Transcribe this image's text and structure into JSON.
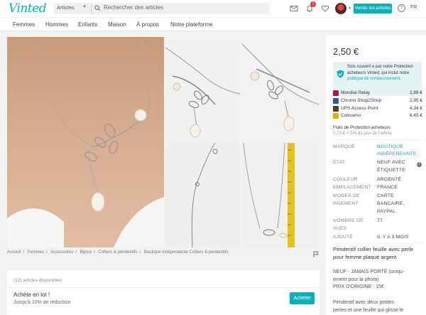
{
  "header": {
    "logo": "Vinted",
    "search_category": "Articles",
    "search_placeholder": "Rechercher des articles",
    "notification_count": "1",
    "sell_button": "Vends tes articles",
    "help": "?",
    "language": "FR"
  },
  "nav": [
    "Femmes",
    "Hommes",
    "Enfants",
    "Maison",
    "À propos",
    "Notre plateforme"
  ],
  "breadcrumb": [
    "Accueil",
    "Femmes",
    "Accessoires",
    "Bijoux",
    "Colliers & pendentifs",
    "Boutique Indépendante Colliers & pendentifs"
  ],
  "bundle": {
    "count_text": "(12) articles disponibles",
    "title": "Achète en lot !",
    "subtitle": "Jusqu'à 10% de réduction",
    "button": "Acheter"
  },
  "item": {
    "price": "2,50 €",
    "protection": {
      "text": "Sois couvert·e par notre Protection acheteurs Vinted, qui inclut notre ",
      "link": "politique de remboursement."
    },
    "shipping": [
      {
        "name": "Mondial Relay",
        "price": "2,88 €",
        "color": "#b0154b"
      },
      {
        "name": "Chrono Shop2Shop",
        "price": "2,95 €",
        "color": "#1f5ea8"
      },
      {
        "name": "UPS Access Point",
        "price": "4,34 €",
        "color": "#5a3a22"
      },
      {
        "name": "Colissimo",
        "price": "6,45 €",
        "color": "#f2a900"
      }
    ],
    "fees_title": "Frais de Protection acheteurs",
    "fees_detail": "0,70 € + 5% du prix de l'article",
    "details": {
      "brand_label": "MARQUE",
      "brand_value_1": "BOUTIQUE",
      "brand_value_2": "INDÉPENDANTE",
      "state_label": "ÉTAT",
      "state_value_1": "NEUF AVEC",
      "state_value_2": "ÉTIQUETTE",
      "color_label": "COULEUR",
      "color_value": "ARGENTÉ",
      "location_label": "EMPLACEMENT",
      "location_value": "FRANCE",
      "payment_label_1": "MODES DE",
      "payment_label_2": "PAIEMENT",
      "payment_value_1": "CARTE",
      "payment_value_2": "BANCAIRE,",
      "payment_value_3": "PAYPAL",
      "views_label_1": "NOMBRE DE",
      "views_label_2": "VUES",
      "views_value": "77",
      "added_label": "AJOUTÉ",
      "added_value": "IL Y A 3 MOIS"
    },
    "description": {
      "title_1": "Pendentif collier feuille avec perle",
      "title_2": "pour femme plaqué argent",
      "line_1": "NEUF - JAMAIS PORTÉ (uniqu-",
      "line_2": "ement pour la photo)",
      "line_3": "PRIX D'ORIGINE : 15€",
      "line_4": "Pendentif avec deux petites",
      "line_5": "perles et une feuille qui glisse le"
    }
  },
  "colors": {
    "accent": "#09b1ba",
    "badge": "#e13a3a"
  }
}
